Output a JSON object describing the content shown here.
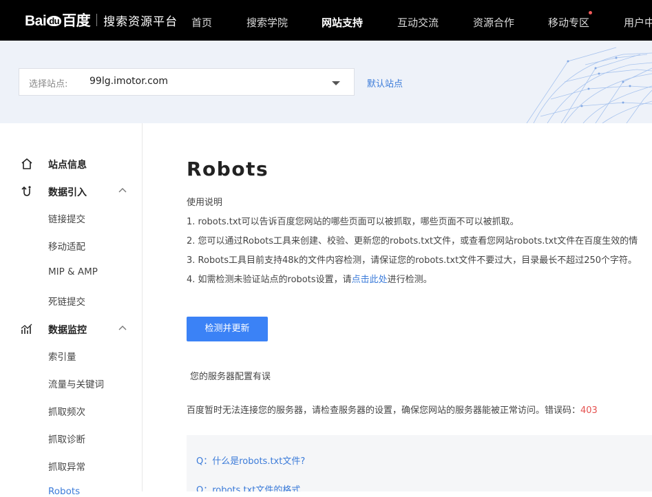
{
  "header": {
    "logo_text_a": "Bai",
    "logo_text_du": "du",
    "logo_text_b": "百度",
    "platform_title": "搜索资源平台",
    "nav": [
      {
        "label": "首页",
        "active": false
      },
      {
        "label": "搜索学院",
        "active": false
      },
      {
        "label": "网站支持",
        "active": true
      },
      {
        "label": "互动交流",
        "active": false
      },
      {
        "label": "资源合作",
        "active": false
      },
      {
        "label": "移动专区",
        "active": false,
        "has_dot": true
      },
      {
        "label": "用户中",
        "active": false
      }
    ]
  },
  "banner": {
    "site_label": "选择站点:",
    "site_value": "99lg.imotor.com",
    "default_site": "默认站点"
  },
  "sidebar": {
    "groups": [
      {
        "label": "站点信息",
        "icon": "home-icon"
      },
      {
        "label": "数据引入",
        "icon": "data-import-icon",
        "items": [
          "链接提交",
          "移动适配",
          "MIP & AMP",
          "死链提交"
        ]
      },
      {
        "label": "数据监控",
        "icon": "data-monitor-icon",
        "items": [
          "索引量",
          "流量与关键词",
          "抓取频次",
          "抓取诊断",
          "抓取异常",
          "Robots"
        ]
      }
    ]
  },
  "main": {
    "title": "Robots",
    "usage_heading": "使用说明",
    "lines": [
      "1. robots.txt可以告诉百度您网站的哪些页面可以被抓取，哪些页面不可以被抓取。",
      "2. 您可以通过Robots工具来创建、校验、更新您的robots.txt文件，或查看您网站robots.txt文件在百度生效的情",
      "3. Robots工具目前支持48k的文件内容检测，请保证您的robots.txt文件不要过大，目录最长不超过250个字符。"
    ],
    "line4_prefix": "4. 如需检测未验证站点的robots设置，请",
    "line4_link": "点击此处",
    "line4_suffix": "进行检测。",
    "check_button": "检测并更新",
    "server_error_title": "您的服务器配置有误",
    "server_error_text": "百度暂时无法连接您的服务器，请检查服务器的设置，确保您网站的服务器能被正常访问。错误码：",
    "error_code": "403",
    "faq": [
      "Q：什么是robots.txt文件?",
      "Q：robots.txt文件的格式"
    ]
  },
  "colors": {
    "accent": "#3b82f6",
    "link": "#3b7bd9",
    "error": "#e5514f",
    "nav_bg": "#000000"
  }
}
